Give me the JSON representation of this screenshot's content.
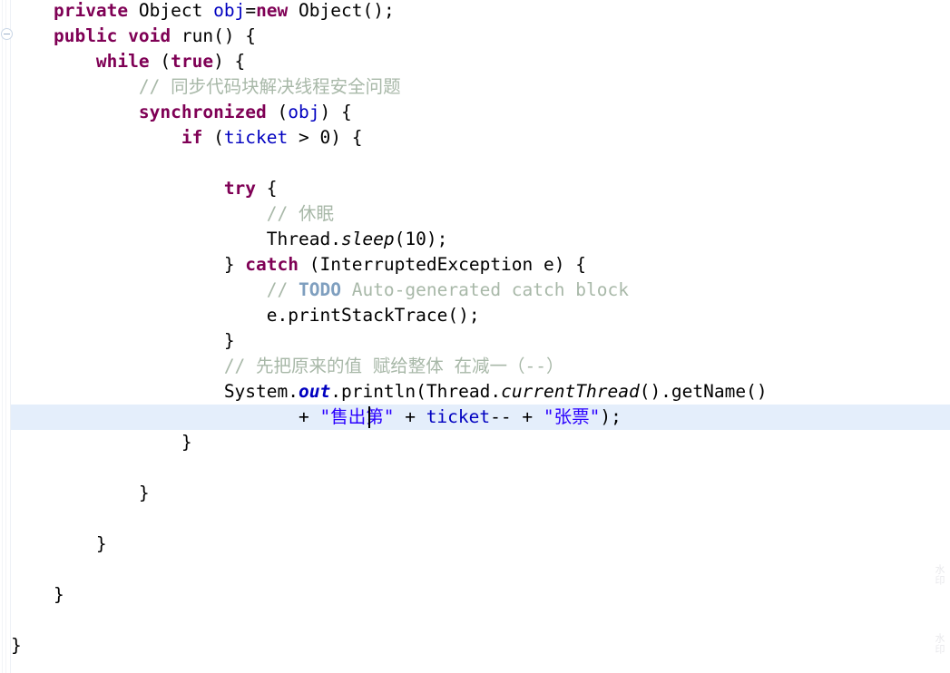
{
  "editor": {
    "language": "java",
    "background": "#ffffff",
    "current_line_highlight": "#e4eefb",
    "caret_line": 16,
    "colors": {
      "keyword": "#7f0055",
      "field": "#0000c0",
      "string": "#2a00ff",
      "comment": "#a8b8a8",
      "comment_tag": "#7f9fbf",
      "plain": "#000000"
    }
  },
  "gutter": {
    "fold_icon": "collapse-minus-icon"
  },
  "watermark": {
    "mark_top": "水印",
    "mark_bottom": "水印"
  },
  "code": {
    "lines": [
      {
        "n": 1,
        "indent": 4,
        "tokens": [
          {
            "t": "private",
            "c": "kw"
          },
          {
            "t": " Object ",
            "c": "plain"
          },
          {
            "t": "obj",
            "c": "field"
          },
          {
            "t": "=",
            "c": "plain"
          },
          {
            "t": "new",
            "c": "kw"
          },
          {
            "t": " Object();",
            "c": "plain"
          }
        ]
      },
      {
        "n": 2,
        "indent": 4,
        "tokens": [
          {
            "t": "public void",
            "c": "kw"
          },
          {
            "t": " run() {",
            "c": "plain"
          }
        ]
      },
      {
        "n": 3,
        "indent": 8,
        "tokens": [
          {
            "t": "while",
            "c": "kw"
          },
          {
            "t": " (",
            "c": "plain"
          },
          {
            "t": "true",
            "c": "kw"
          },
          {
            "t": ") {",
            "c": "plain"
          }
        ]
      },
      {
        "n": 4,
        "indent": 12,
        "tokens": [
          {
            "t": "// 同步代码块解决线程安全问题",
            "c": "cmt"
          }
        ]
      },
      {
        "n": 5,
        "indent": 12,
        "tokens": [
          {
            "t": "synchronized",
            "c": "kw"
          },
          {
            "t": " (",
            "c": "plain"
          },
          {
            "t": "obj",
            "c": "field"
          },
          {
            "t": ") {",
            "c": "plain"
          }
        ]
      },
      {
        "n": 6,
        "indent": 16,
        "tokens": [
          {
            "t": "if",
            "c": "kw"
          },
          {
            "t": " (",
            "c": "plain"
          },
          {
            "t": "ticket",
            "c": "field"
          },
          {
            "t": " > 0) {",
            "c": "plain"
          }
        ]
      },
      {
        "n": 7,
        "indent": 0,
        "tokens": []
      },
      {
        "n": 8,
        "indent": 20,
        "tokens": [
          {
            "t": "try",
            "c": "kw"
          },
          {
            "t": " {",
            "c": "plain"
          }
        ]
      },
      {
        "n": 9,
        "indent": 24,
        "tokens": [
          {
            "t": "// 休眠",
            "c": "cmt"
          }
        ]
      },
      {
        "n": 10,
        "indent": 24,
        "tokens": [
          {
            "t": "Thread.",
            "c": "plain"
          },
          {
            "t": "sleep",
            "c": "stat"
          },
          {
            "t": "(10);",
            "c": "plain"
          }
        ]
      },
      {
        "n": 11,
        "indent": 20,
        "tokens": [
          {
            "t": "} ",
            "c": "plain"
          },
          {
            "t": "catch",
            "c": "kw"
          },
          {
            "t": " (InterruptedException e) {",
            "c": "plain"
          }
        ]
      },
      {
        "n": 12,
        "indent": 24,
        "tokens": [
          {
            "t": "// ",
            "c": "cmt"
          },
          {
            "t": "TODO",
            "c": "cmt-tag"
          },
          {
            "t": " Auto-generated catch block",
            "c": "cmt"
          }
        ]
      },
      {
        "n": 13,
        "indent": 24,
        "tokens": [
          {
            "t": "e.printStackTrace();",
            "c": "plain"
          }
        ]
      },
      {
        "n": 14,
        "indent": 20,
        "tokens": [
          {
            "t": "}",
            "c": "plain"
          }
        ]
      },
      {
        "n": 15,
        "indent": 20,
        "tokens": [
          {
            "t": "// 先把原来的值 赋给整体 在减一（--）",
            "c": "cmt"
          }
        ]
      },
      {
        "n": 16,
        "indent": 20,
        "tokens": [
          {
            "t": "System.",
            "c": "plain"
          },
          {
            "t": "out",
            "c": "statf"
          },
          {
            "t": ".println(Thread.",
            "c": "plain"
          },
          {
            "t": "currentThread",
            "c": "stat"
          },
          {
            "t": "().getName()",
            "c": "plain"
          }
        ]
      },
      {
        "n": 17,
        "indent": 27,
        "current": true,
        "tokens": [
          {
            "t": "+ ",
            "c": "plain"
          },
          {
            "t": "\"售出第\"",
            "c": "str"
          },
          {
            "t": " + ",
            "c": "plain"
          },
          {
            "t": "ticket",
            "c": "field"
          },
          {
            "t": "-- + ",
            "c": "plain"
          },
          {
            "t": "\"张票\"",
            "c": "str"
          },
          {
            "t": ");",
            "c": "plain"
          }
        ]
      },
      {
        "n": 18,
        "indent": 16,
        "tokens": [
          {
            "t": "}",
            "c": "plain"
          }
        ]
      },
      {
        "n": 19,
        "indent": 0,
        "tokens": []
      },
      {
        "n": 20,
        "indent": 12,
        "tokens": [
          {
            "t": "}",
            "c": "plain"
          }
        ]
      },
      {
        "n": 21,
        "indent": 0,
        "tokens": []
      },
      {
        "n": 22,
        "indent": 8,
        "tokens": [
          {
            "t": "}",
            "c": "plain"
          }
        ]
      },
      {
        "n": 23,
        "indent": 0,
        "tokens": []
      },
      {
        "n": 24,
        "indent": 4,
        "tokens": [
          {
            "t": "}",
            "c": "plain"
          }
        ]
      },
      {
        "n": 25,
        "indent": 0,
        "tokens": []
      },
      {
        "n": 26,
        "indent": 0,
        "tokens": [
          {
            "t": "}",
            "c": "plain"
          }
        ]
      }
    ]
  }
}
